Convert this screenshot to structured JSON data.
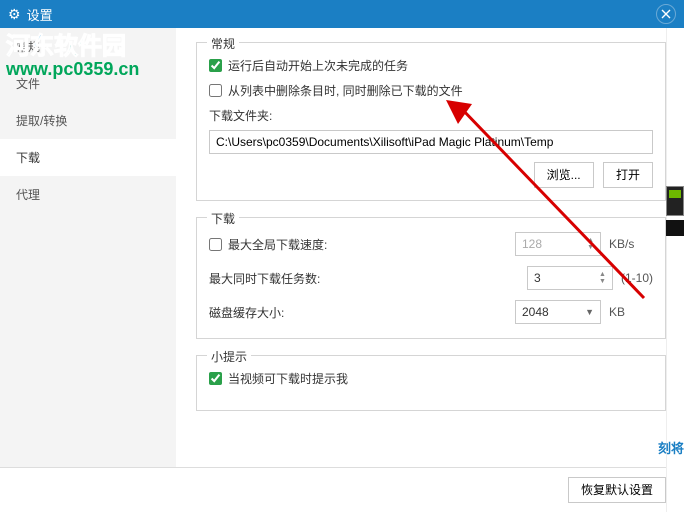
{
  "window": {
    "title": "设置"
  },
  "sidebar": {
    "items": [
      {
        "label": "常规"
      },
      {
        "label": "文件"
      },
      {
        "label": "提取/转换"
      },
      {
        "label": "下载"
      },
      {
        "label": "代理"
      }
    ]
  },
  "general": {
    "title": "常规",
    "opt_autostart": "运行后自动开始上次未完成的任务",
    "opt_delete_files": "从列表中删除条目时, 同时删除已下载的文件",
    "download_folder_label": "下载文件夹:",
    "path_value": "C:\\Users\\pc0359\\Documents\\Xilisoft\\iPad Magic Platinum\\Temp",
    "browse": "浏览...",
    "open": "打开"
  },
  "download": {
    "title": "下载",
    "max_global_label": "最大全局下载速度:",
    "max_global_value": "128",
    "kbs": "KB/s",
    "max_tasks_label": "最大同时下载任务数:",
    "max_tasks_value": "3",
    "max_tasks_range": "(1-10)",
    "disk_cache_label": "磁盘缓存大小:",
    "disk_cache_value": "2048",
    "kb": "KB"
  },
  "tip": {
    "title": "小提示",
    "prompt_label": "当视频可下载时提示我"
  },
  "footer": {
    "restore": "恢复默认设置"
  },
  "watermark": {
    "line1a": "河东",
    "line1b": "软件园",
    "line2": "www.pc0359.cn"
  },
  "right_text": "刻将"
}
